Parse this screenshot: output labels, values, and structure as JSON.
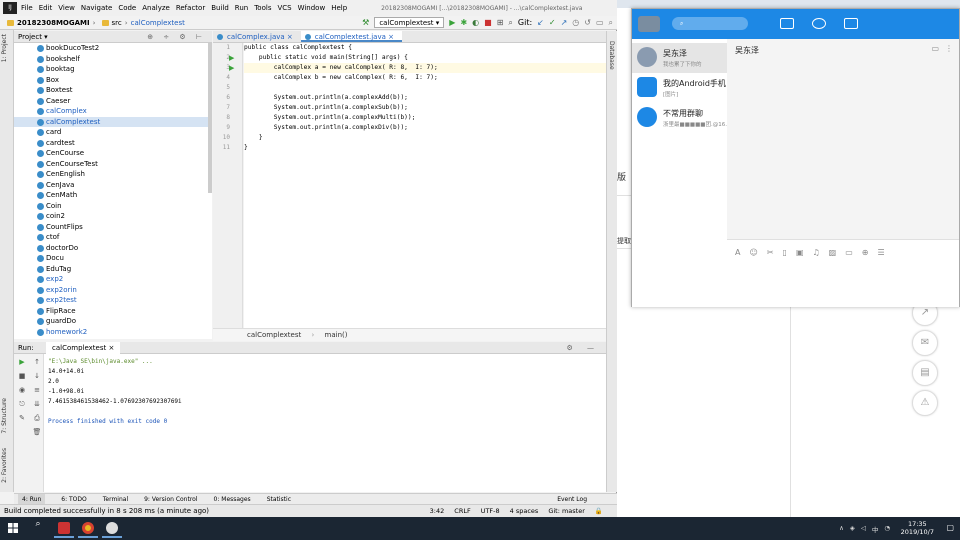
{
  "menubar": {
    "items": [
      "File",
      "Edit",
      "View",
      "Navigate",
      "Code",
      "Analyze",
      "Refactor",
      "Build",
      "Run",
      "Tools",
      "VCS",
      "Window",
      "Help"
    ],
    "window_title": "20182308MOGAMI [...\\20182308MOGAMI] - ...\\calComplextest.java"
  },
  "toolbar": {
    "project": "20182308MOGAMI",
    "src": "src",
    "file": "calComplextest",
    "run_config": "calComplextest",
    "git_label": "Git:"
  },
  "project_panel": {
    "title": "Project",
    "items": [
      {
        "label": "bookDucoTest2",
        "style": ""
      },
      {
        "label": "bookshelf",
        "style": ""
      },
      {
        "label": "booktag",
        "style": ""
      },
      {
        "label": "Box",
        "style": ""
      },
      {
        "label": "Boxtest",
        "style": ""
      },
      {
        "label": "Caeser",
        "style": ""
      },
      {
        "label": "calComplex",
        "style": "blue"
      },
      {
        "label": "calComplextest",
        "style": "sel"
      },
      {
        "label": "card",
        "style": ""
      },
      {
        "label": "cardtest",
        "style": ""
      },
      {
        "label": "CenCourse",
        "style": ""
      },
      {
        "label": "CenCourseTest",
        "style": ""
      },
      {
        "label": "CenEnglish",
        "style": ""
      },
      {
        "label": "CenJava",
        "style": ""
      },
      {
        "label": "CenMath",
        "style": ""
      },
      {
        "label": "Coin",
        "style": ""
      },
      {
        "label": "coin2",
        "style": ""
      },
      {
        "label": "CountFlips",
        "style": ""
      },
      {
        "label": "ctof",
        "style": ""
      },
      {
        "label": "doctorDo",
        "style": ""
      },
      {
        "label": "Docu",
        "style": ""
      },
      {
        "label": "EduTag",
        "style": ""
      },
      {
        "label": "exp2",
        "style": "blue"
      },
      {
        "label": "exp2orin",
        "style": "blue"
      },
      {
        "label": "exp2test",
        "style": "blue"
      },
      {
        "label": "FlipRace",
        "style": ""
      },
      {
        "label": "guardDo",
        "style": ""
      },
      {
        "label": "homework2",
        "style": "blue"
      }
    ]
  },
  "left_strip": {
    "project_tab": "1: Project",
    "structure_tab": "7: Structure",
    "favorites_tab": "2: Favorites"
  },
  "right_strip": {
    "database_tab": "Database"
  },
  "editor": {
    "tabs": [
      {
        "label": "calComplex.java",
        "active": false
      },
      {
        "label": "calComplextest.java",
        "active": true
      }
    ],
    "line_numbers": [
      "1",
      "2",
      "3",
      "4",
      "5",
      "6",
      "7",
      "8",
      "9",
      "10",
      "11"
    ],
    "lines": [
      "public class calComplextest {",
      "    public static void main(String[] args) {",
      "        calComplex a = new calComplex( R: 8,  I: 7);",
      "        calComplex b = new calComplex( R: 6,  I: 7);",
      "",
      "        System.out.println(a.complexAdd(b));",
      "        System.out.println(a.complexSub(b));",
      "        System.out.println(a.complexMulti(b));",
      "        System.out.println(a.complexDiv(b));",
      "    }",
      "}"
    ],
    "breadcrumb": [
      "calComplextest",
      "main()"
    ]
  },
  "run_panel": {
    "label": "Run:",
    "config": "calComplextest",
    "output": [
      {
        "text": "\"E:\\Java SE\\bin\\java.exe\" ...",
        "cls": "cmd"
      },
      {
        "text": "14.0+14.0i",
        "cls": ""
      },
      {
        "text": "2.0",
        "cls": ""
      },
      {
        "text": "-1.0+98.0i",
        "cls": ""
      },
      {
        "text": "7.461538461538462-1.0769230769230769i",
        "cls": ""
      },
      {
        "text": "",
        "cls": ""
      },
      {
        "text": "Process finished with exit code 0",
        "cls": "fin"
      }
    ]
  },
  "bottom_tabs": [
    "4: Run",
    "6: TODO",
    "Terminal",
    "9: Version Control",
    "0: Messages",
    "Statistic"
  ],
  "event_log": "Event Log",
  "status": {
    "message": "Build completed successfully in 8 s 208 ms (a minute ago)",
    "position": "3:42",
    "line_sep": "CRLF",
    "encoding": "UTF-8",
    "indent": "4 spaces",
    "git": "Git: master"
  },
  "qq": {
    "search_placeholder": "",
    "contacts": [
      {
        "name": "吴东泽",
        "sub": "我也累了下你的",
        "selected": true
      },
      {
        "name": "我的Android手机",
        "sub": "[图片]",
        "selected": false
      },
      {
        "name": "不常用群聊",
        "sub": "浙里最■■■■■团.@16…",
        "selected": false
      }
    ],
    "chat_title": "吴东泽"
  },
  "background_text": {
    "ban": "版",
    "detail": "提取"
  },
  "taskbar": {
    "time": "17:35",
    "date": "2019/10/7",
    "tray": [
      "∧",
      "中"
    ]
  }
}
